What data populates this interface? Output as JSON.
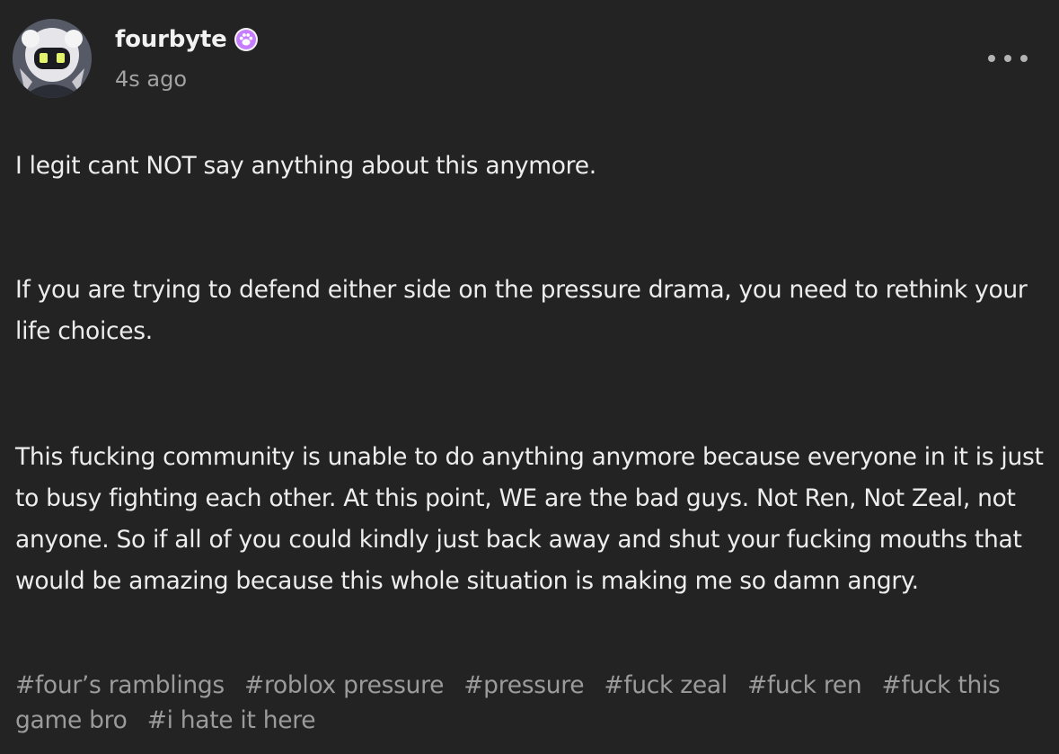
{
  "post": {
    "author": {
      "username": "fourbyte",
      "timestamp": "4s ago",
      "avatar_icon": "robot-avatar-icon",
      "badge_icon": "paw-badge-icon",
      "badge_color": "#c77dff"
    },
    "more_menu_icon": "more-dots-icon",
    "paragraphs": [
      "I legit cant NOT say anything about this anymore.",
      "If you are trying to defend either side on the pressure drama, you need to rethink your life choices.",
      "This fucking community is unable to do anything anymore because everyone in it is just to busy fighting each other. At this point, WE are the bad guys. Not Ren, Not Zeal, not anyone. So if all of you could kindly just back away and shut your fucking mouths that would be amazing because this whole situation is making me so damn angry."
    ],
    "tags": [
      "#four’s ramblings",
      "#roblox pressure",
      "#pressure",
      "#fuck zeal",
      "#fuck ren",
      "#fuck this game bro",
      "#i hate it here"
    ]
  },
  "colors": {
    "background": "#232323",
    "text": "#ededed",
    "muted_text": "#a2a2a2",
    "tag_text": "#9b9b9b"
  }
}
